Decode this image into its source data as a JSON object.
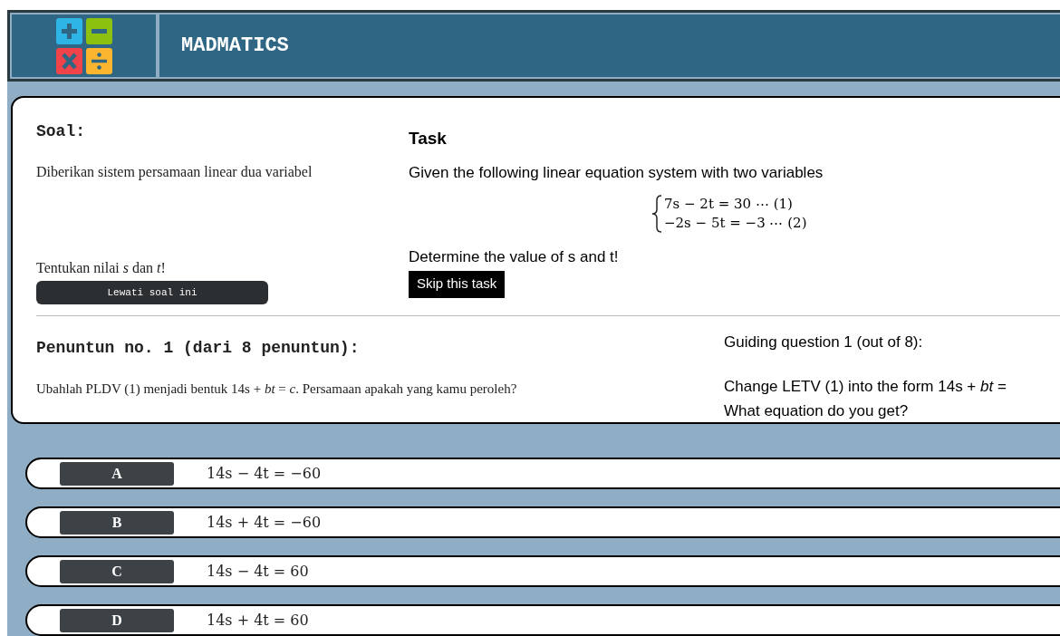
{
  "header": {
    "title": "MADMATICS"
  },
  "task": {
    "heading_id": "Soal:",
    "intro_id": "Diberikan sistem persamaan linear dua variabel",
    "question_id": "Tentukan nilai *s* dan *t*!",
    "skip_id": "Lewati soal ini",
    "heading_en": "Task",
    "intro_en": "Given the following linear equation system with two variables",
    "equations": [
      "7s − 2t = 30 ⋯ (1)",
      "−2s − 5t = −3 ⋯ (2)"
    ],
    "question_en": "Determine the value of s and t!",
    "skip_en": "Skip this task"
  },
  "guide": {
    "heading_id": "Penuntun no. 1 (dari 8 penuntun):",
    "text_id": "Ubahlah PLDV (1) menjadi bentuk 14s + *bt* = *c*. Persamaan apakah yang kamu peroleh?",
    "heading_en": "Guiding question 1 (out of 8):",
    "text_en_1": "Change LETV (1) into the form 14s + *bt* =",
    "text_en_2": "What equation do you get?"
  },
  "options": [
    {
      "letter": "A",
      "answer": "14s − 4t = −60"
    },
    {
      "letter": "B",
      "answer": "14s + 4t = −60"
    },
    {
      "letter": "C",
      "answer": "14s − 4t = 60"
    },
    {
      "letter": "D",
      "answer": "14s + 4t = 60"
    }
  ]
}
